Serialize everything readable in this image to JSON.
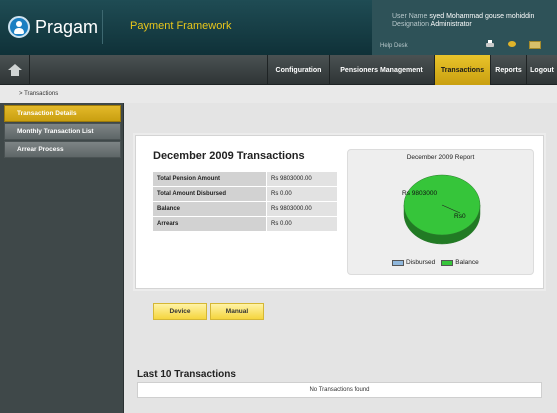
{
  "header": {
    "logo_text": "Pragam",
    "app_title": "Payment Framework",
    "user_name_label": "User Name",
    "user_name": "syed Mohammad gouse mohiddin",
    "designation_label": "Designation",
    "designation": "Administrator",
    "help_desk": "Help Desk",
    "icons": [
      "printer-icon",
      "chat-icon",
      "mail-icon"
    ]
  },
  "nav": {
    "home_icon": "home-icon",
    "items": [
      {
        "label": "Configuration"
      },
      {
        "label": "Pensioners Management"
      },
      {
        "label": "Transactions",
        "active": true
      },
      {
        "label": "Reports"
      },
      {
        "label": "Logout"
      }
    ]
  },
  "breadcrumb": "> Transactions",
  "sidebar": {
    "items": [
      {
        "label": "Transaction Details",
        "active": true
      },
      {
        "label": "Monthly Transaction List"
      },
      {
        "label": "Arrear Process"
      }
    ]
  },
  "main": {
    "title": "December 2009 Transactions",
    "summary": [
      {
        "label": "Total Pension Amount",
        "value": "Rs 9803000.00"
      },
      {
        "label": "Total Amount Disbursed",
        "value": "Rs 0.00"
      },
      {
        "label": "Balance",
        "value": "Rs 9803000.00"
      },
      {
        "label": "Arrears",
        "value": "Rs 0.00"
      }
    ],
    "buttons": {
      "device": "Device",
      "manual": "Manual"
    },
    "last_title": "Last 10 Transactions",
    "no_transactions": "No Transactions found"
  },
  "chart_data": {
    "type": "pie",
    "title": "December 2009 Report",
    "slices": [
      {
        "name": "Disbursed",
        "value": 0,
        "label": "Rs0",
        "color": "#8fb7dc"
      },
      {
        "name": "Balance",
        "value": 9803000,
        "label": "Rs 9803000",
        "color": "#36c53a"
      }
    ],
    "legend": "bottom"
  },
  "colors": {
    "accent": "#e2b72a",
    "header": "#0f3138",
    "app_title": "#e8c61b"
  }
}
